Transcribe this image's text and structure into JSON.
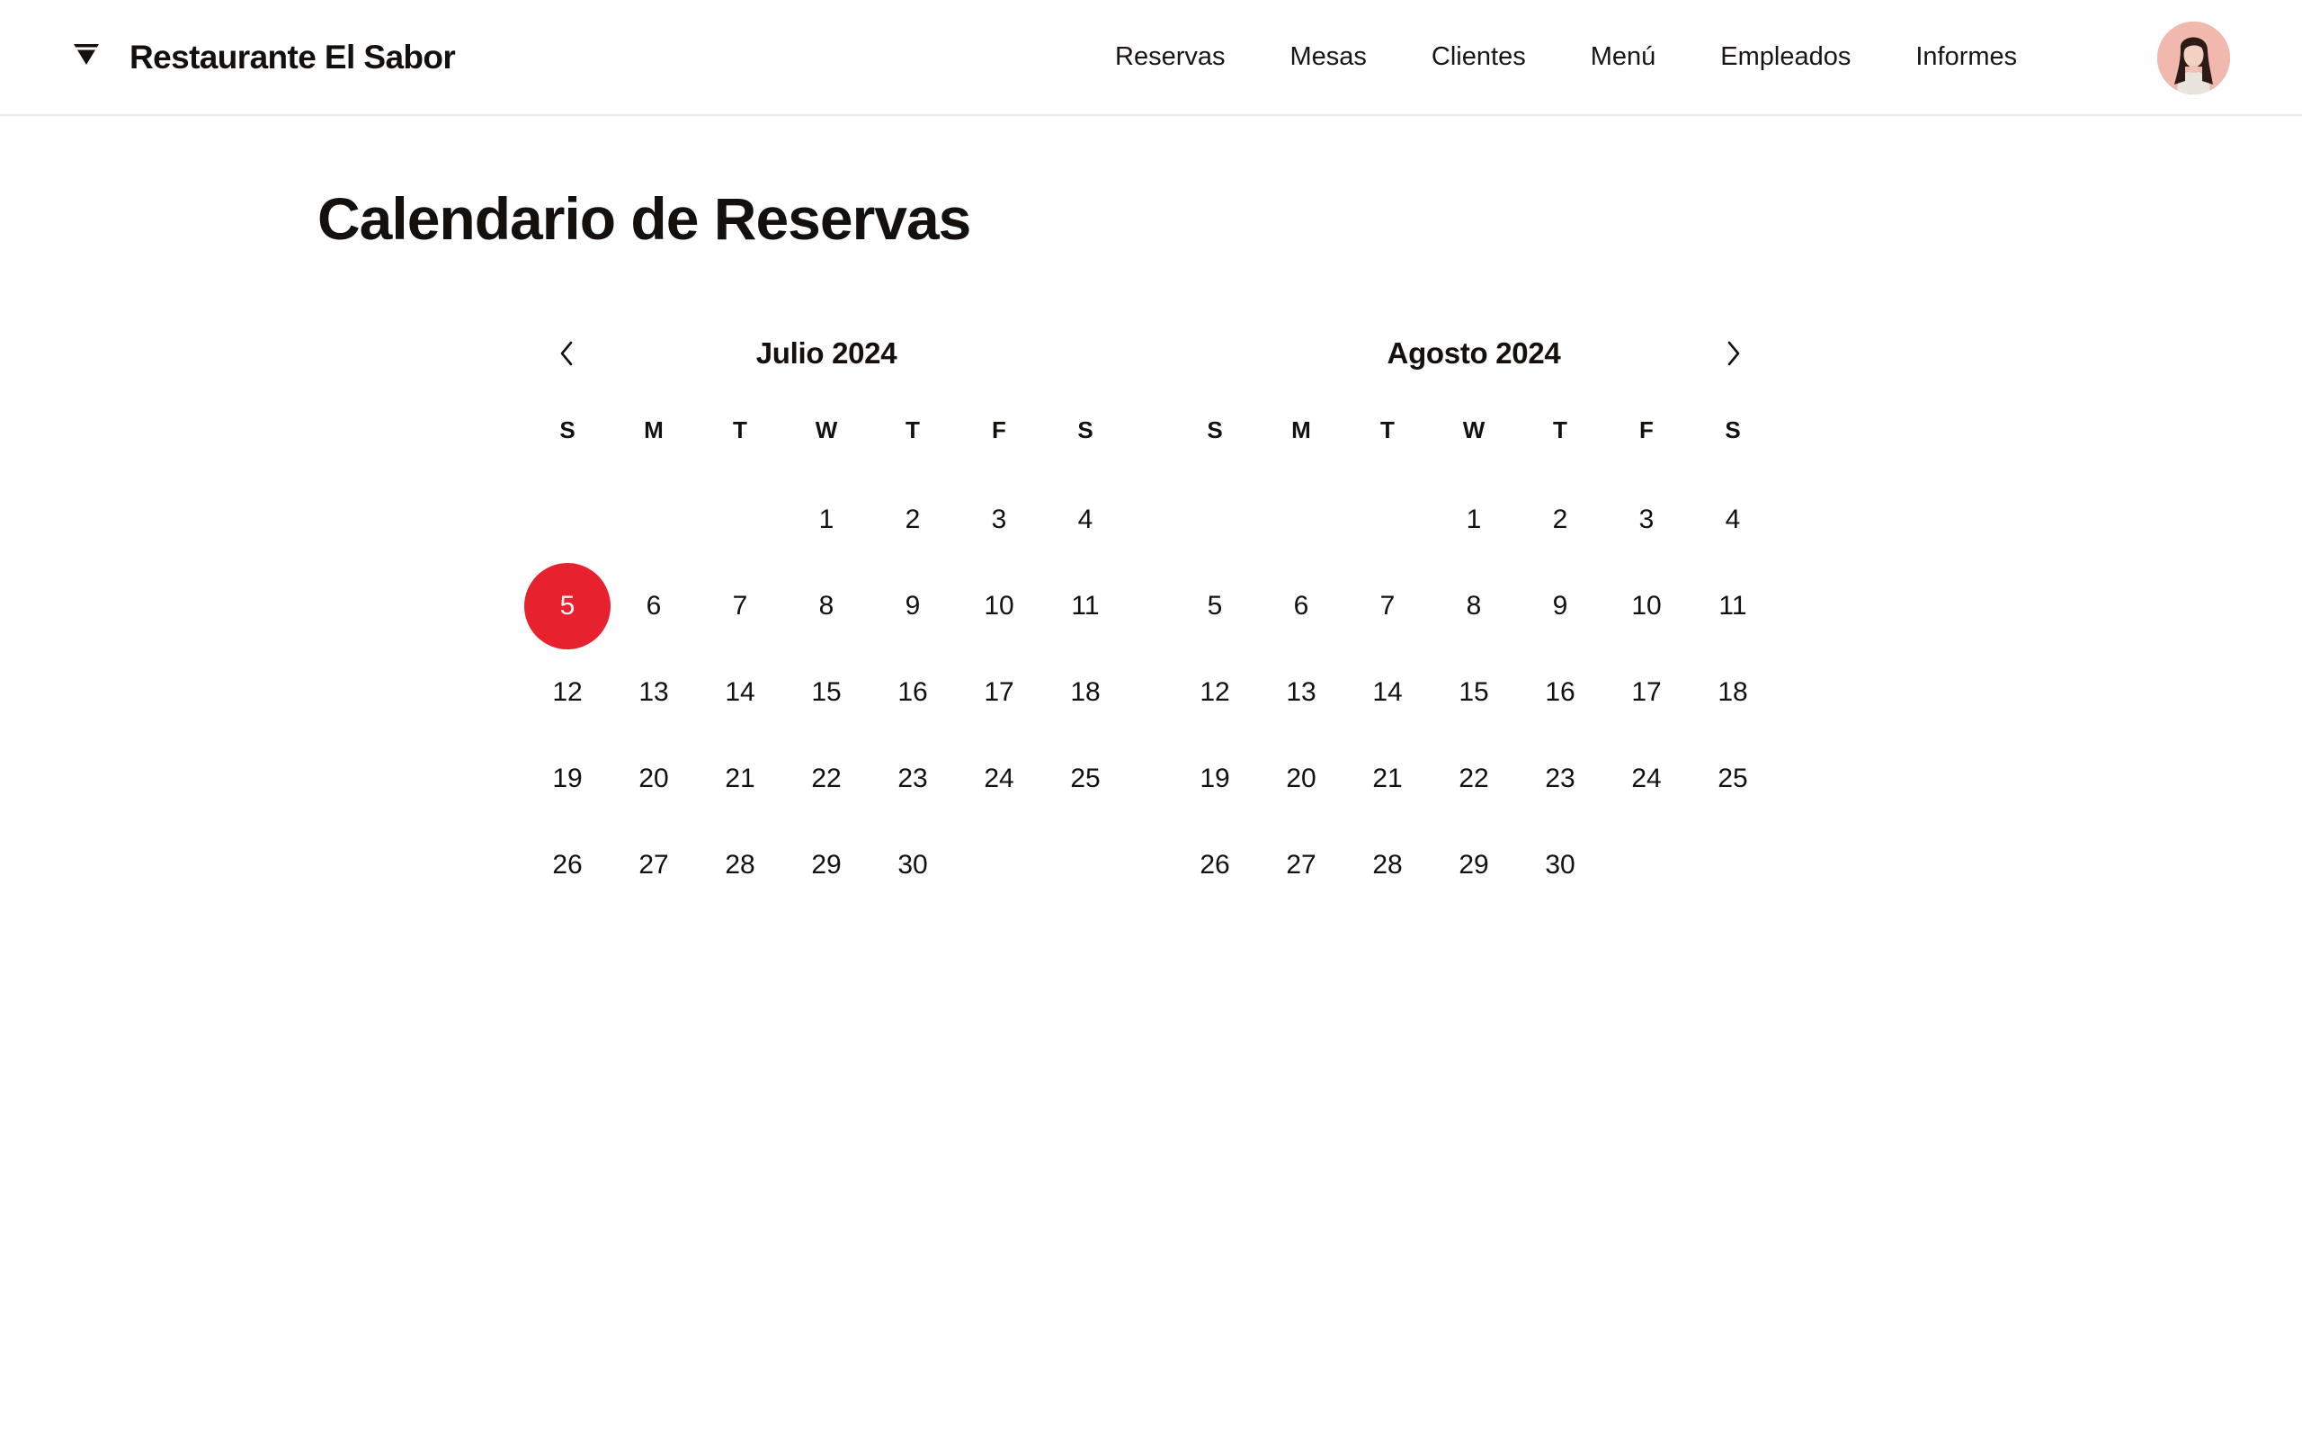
{
  "header": {
    "brand": "Restaurante El Sabor",
    "logo_icon": "wine-glass-icon",
    "nav": [
      {
        "label": "Reservas"
      },
      {
        "label": "Mesas"
      },
      {
        "label": "Clientes"
      },
      {
        "label": "Menú"
      },
      {
        "label": "Empleados"
      },
      {
        "label": "Informes"
      }
    ],
    "avatar_icon": "user-avatar"
  },
  "page": {
    "title": "Calendario de Reservas"
  },
  "calendar": {
    "accent_color": "#e8212f",
    "prev_icon": "chevron-left-icon",
    "next_icon": "chevron-right-icon",
    "selected": {
      "month_index": 0,
      "day": "5"
    },
    "weekday_labels": [
      "S",
      "M",
      "T",
      "W",
      "T",
      "F",
      "S"
    ],
    "months": [
      {
        "title": "Julio 2024",
        "weeks": [
          [
            "",
            "",
            "",
            "1",
            "2",
            "3",
            "4"
          ],
          [
            "5",
            "6",
            "7",
            "8",
            "9",
            "10",
            "11"
          ],
          [
            "12",
            "13",
            "14",
            "15",
            "16",
            "17",
            "18"
          ],
          [
            "19",
            "20",
            "21",
            "22",
            "23",
            "24",
            "25"
          ],
          [
            "26",
            "27",
            "28",
            "29",
            "30",
            "",
            ""
          ]
        ]
      },
      {
        "title": "Agosto 2024",
        "weeks": [
          [
            "",
            "",
            "",
            "1",
            "2",
            "3",
            "4"
          ],
          [
            "5",
            "6",
            "7",
            "8",
            "9",
            "10",
            "11"
          ],
          [
            "12",
            "13",
            "14",
            "15",
            "16",
            "17",
            "18"
          ],
          [
            "19",
            "20",
            "21",
            "22",
            "23",
            "24",
            "25"
          ],
          [
            "26",
            "27",
            "28",
            "29",
            "30",
            "",
            ""
          ]
        ]
      }
    ]
  }
}
